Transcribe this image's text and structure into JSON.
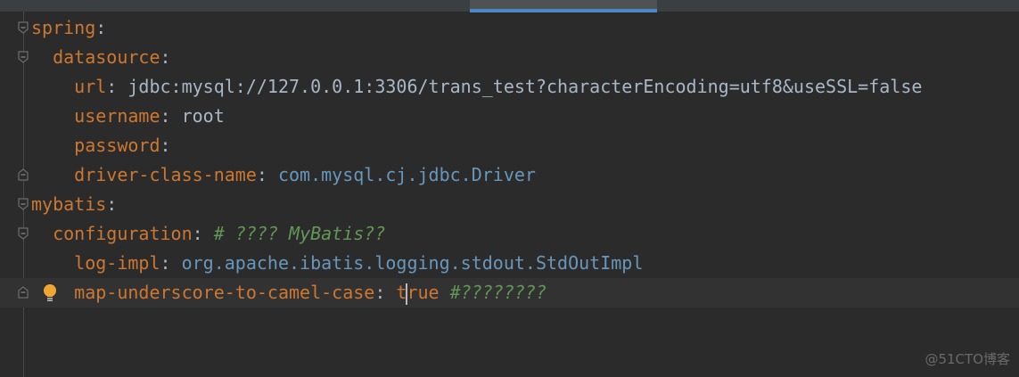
{
  "editor": {
    "lines": [
      {
        "indent": 0,
        "key": "spring",
        "value": "",
        "value_type": "none",
        "comment": "",
        "fold": "open"
      },
      {
        "indent": 1,
        "key": "datasource",
        "value": "",
        "value_type": "none",
        "comment": "",
        "fold": "open"
      },
      {
        "indent": 2,
        "key": "url",
        "value": "jdbc:mysql://127.0.0.1:3306/trans_test?characterEncoding=utf8&useSSL=false",
        "value_type": "plain",
        "comment": "",
        "fold": ""
      },
      {
        "indent": 2,
        "key": "username",
        "value": "root",
        "value_type": "plain",
        "comment": "",
        "fold": ""
      },
      {
        "indent": 2,
        "key": "password",
        "value": "",
        "value_type": "none",
        "comment": "",
        "fold": ""
      },
      {
        "indent": 2,
        "key": "driver-class-name",
        "value": "com.mysql.cj.jdbc.Driver",
        "value_type": "class",
        "comment": "",
        "fold": "close"
      },
      {
        "indent": 0,
        "key": "mybatis",
        "value": "",
        "value_type": "none",
        "comment": "",
        "fold": "open"
      },
      {
        "indent": 1,
        "key": "configuration",
        "value": "",
        "value_type": "none",
        "comment": "# ???? MyBatis??",
        "fold": "open"
      },
      {
        "indent": 2,
        "key": "log-impl",
        "value": "org.apache.ibatis.logging.stdout.StdOutImpl",
        "value_type": "class",
        "comment": "",
        "fold": ""
      },
      {
        "indent": 2,
        "key": "map-underscore-to-camel-case",
        "value": "true",
        "value_type": "bool",
        "comment": "#????????",
        "fold": "close",
        "current": true,
        "caret_after": 1,
        "bulb": true
      }
    ]
  },
  "watermark": "@51CTO博客",
  "colors": {
    "key": "#cc7832",
    "comment": "#629755",
    "class_value": "#6897bb",
    "plain_value": "#a9b7c6",
    "tab_accent": "#4a88c7"
  }
}
